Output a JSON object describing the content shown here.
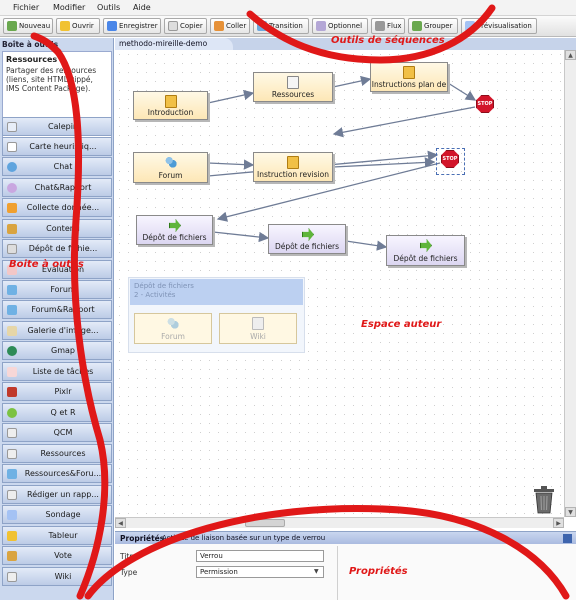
{
  "menu": [
    "Fichier",
    "Modifier",
    "Outils",
    "Aide"
  ],
  "toolbar": [
    {
      "label": "Nouveau",
      "icon": "new-icon",
      "color": "#6aa84f"
    },
    {
      "label": "Ouvrir",
      "icon": "open-folder-icon",
      "color": "#f1c232"
    },
    {
      "label": "Enregistrer",
      "icon": "save-icon",
      "color": "#4a86e8"
    },
    {
      "label": "Copier",
      "icon": "copy-icon",
      "color": "#dddddd"
    },
    {
      "label": "Coller",
      "icon": "paste-icon",
      "color": "#e69138"
    },
    {
      "label": "Transition",
      "icon": "transition-icon",
      "color": "#6fa8dc"
    },
    {
      "label": "Optionnel",
      "icon": "optional-icon",
      "color": "#b4a7d6"
    },
    {
      "label": "Flux",
      "icon": "flow-icon",
      "color": "#999999"
    },
    {
      "label": "Grouper",
      "icon": "group-icon",
      "color": "#6aa84f"
    },
    {
      "label": "Prévisualisation",
      "icon": "preview-icon",
      "color": "#a4c2f4"
    }
  ],
  "toolbox": {
    "title": "Boîte à outils",
    "info_title": "Ressources",
    "info_desc": "Partager des ressources (liens, site HTML zippé, IMS Content Package).",
    "items": [
      {
        "label": "Calepin",
        "icon": "notebook-icon",
        "color": "#e8eef8"
      },
      {
        "label": "Carte heuristiq...",
        "icon": "mindmap-icon",
        "color": "#ffffff"
      },
      {
        "label": "Chat",
        "icon": "chat-bubble-icon",
        "color": "#5fa4de"
      },
      {
        "label": "Chat&Rapport",
        "icon": "chat-report-icon",
        "color": "#c9a7e0"
      },
      {
        "label": "Collecte donnée...",
        "icon": "data-collection-icon",
        "color": "#f0a030"
      },
      {
        "label": "Contenu",
        "icon": "content-icon",
        "color": "#d9a441"
      },
      {
        "label": "Dépôt de fichie...",
        "icon": "file-upload-icon",
        "color": "#dddddd"
      },
      {
        "label": "Evaluation",
        "icon": "evaluation-icon",
        "color": "#f3c7c7"
      },
      {
        "label": "Forum",
        "icon": "forum-icon",
        "color": "#6fb1e4"
      },
      {
        "label": "Forum&Rapport",
        "icon": "forum-report-icon",
        "color": "#6fb1e4"
      },
      {
        "label": "Galerie d'image...",
        "icon": "image-gallery-icon",
        "color": "#e6d6a8"
      },
      {
        "label": "Gmap",
        "icon": "globe-icon",
        "color": "#2e8b57"
      },
      {
        "label": "Liste de tâches",
        "icon": "task-list-icon",
        "color": "#f7d7d7"
      },
      {
        "label": "Pixlr",
        "icon": "pixlr-icon",
        "color": "#c0392b"
      },
      {
        "label": "Q et R",
        "icon": "qa-icon",
        "color": "#7cc242"
      },
      {
        "label": "QCM",
        "icon": "quiz-icon",
        "color": "#eeeeee"
      },
      {
        "label": "Ressources",
        "icon": "resources-icon",
        "color": "#eeeeee"
      },
      {
        "label": "Ressources&Foru...",
        "icon": "resources-forum-icon",
        "color": "#6fb1e4"
      },
      {
        "label": "Rédiger un rapp...",
        "icon": "write-report-icon",
        "color": "#eeeeee"
      },
      {
        "label": "Sondage",
        "icon": "survey-icon",
        "color": "#a4c2f4"
      },
      {
        "label": "Tableur",
        "icon": "spreadsheet-icon",
        "color": "#f1c232"
      },
      {
        "label": "Vote",
        "icon": "vote-icon",
        "color": "#d9a441"
      },
      {
        "label": "Wiki",
        "icon": "wiki-icon",
        "color": "#eeeeee"
      }
    ]
  },
  "workspace": {
    "tab": "methodo-mireille-demo",
    "nodes": [
      {
        "id": "introduction",
        "label": "Introduction",
        "kind": "res",
        "icon": "doc"
      },
      {
        "id": "ressources",
        "label": "Ressources",
        "kind": "res",
        "icon": "doc"
      },
      {
        "id": "instructions",
        "label": "Instructions plan de",
        "kind": "res",
        "icon": "doc"
      },
      {
        "id": "forum",
        "label": "Forum",
        "kind": "res",
        "icon": "people"
      },
      {
        "id": "instruction-revision",
        "label": "Instruction revision",
        "kind": "res",
        "icon": "doc"
      },
      {
        "id": "depot1",
        "label": "Dépôt de fichiers",
        "kind": "col",
        "icon": "arrow"
      },
      {
        "id": "depot2",
        "label": "Dépôt de fichiers",
        "kind": "col",
        "icon": "arrow"
      },
      {
        "id": "depot3",
        "label": "Dépôt de fichiers",
        "kind": "col",
        "icon": "arrow"
      }
    ],
    "stop_label": "STOP",
    "optional_group": {
      "title": "Dépôt de fichiers",
      "subtitle": "2 - Activités",
      "items": [
        "Forum",
        "Wiki"
      ]
    }
  },
  "properties": {
    "label": "Propriétés",
    "description": "Activité de liaison basée sur un type de verrou",
    "fields": [
      {
        "label": "Titre",
        "value": "Verrou"
      },
      {
        "label": "Type",
        "value": "Permission"
      }
    ]
  },
  "annotations": {
    "sequence_tools": "Outils de séquences",
    "toolbox": "Boite à outils",
    "author_space": "Espace auteur",
    "properties": "Propriétés"
  },
  "colors": {
    "annotation": "#e01818",
    "toolbox_bg": "#cbd8ee",
    "stop": "#d2152a"
  }
}
